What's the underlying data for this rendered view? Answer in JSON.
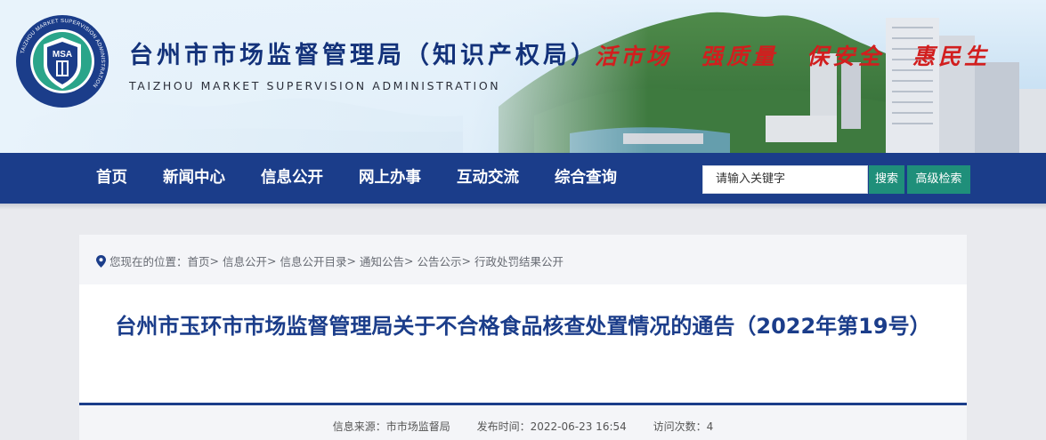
{
  "header": {
    "title": "台州市市场监督管理局（知识产权局）",
    "subtitle": "TAIZHOU MARKET SUPERVISION ADMINISTRATION",
    "logo_text": "MSA",
    "logo_ring_text": "TAIZHOU MARKET SUPERVISION ADMINISTRATION",
    "slogans": [
      "活市场",
      "强质量",
      "保安全",
      "惠民生"
    ]
  },
  "nav": {
    "items": [
      "首页",
      "新闻中心",
      "信息公开",
      "网上办事",
      "互动交流",
      "综合查询"
    ],
    "search_placeholder": "请输入关键字",
    "search_button": "搜索",
    "advanced_button": "高级检索"
  },
  "breadcrumb": {
    "prefix": "您现在的位置：",
    "items": [
      "首页",
      "信息公开",
      "信息公开目录",
      "通知公告",
      "公告公示",
      "行政处罚结果公开"
    ],
    "separator": ">"
  },
  "article": {
    "title": "台州市玉环市市场监督管理局关于不合格食品核查处置情况的通告（2022年第19号）",
    "source_label": "信息来源：",
    "source": "市市场监督局",
    "published_label": "发布时间：",
    "published": "2022-06-23 16:54",
    "visits_label": "访问次数：",
    "visits": "4"
  },
  "colors": {
    "nav_bg": "#1b3d8a",
    "title_blue": "#13327a",
    "slogan_red": "#d21e1e",
    "button_green": "#1f8f7a"
  }
}
